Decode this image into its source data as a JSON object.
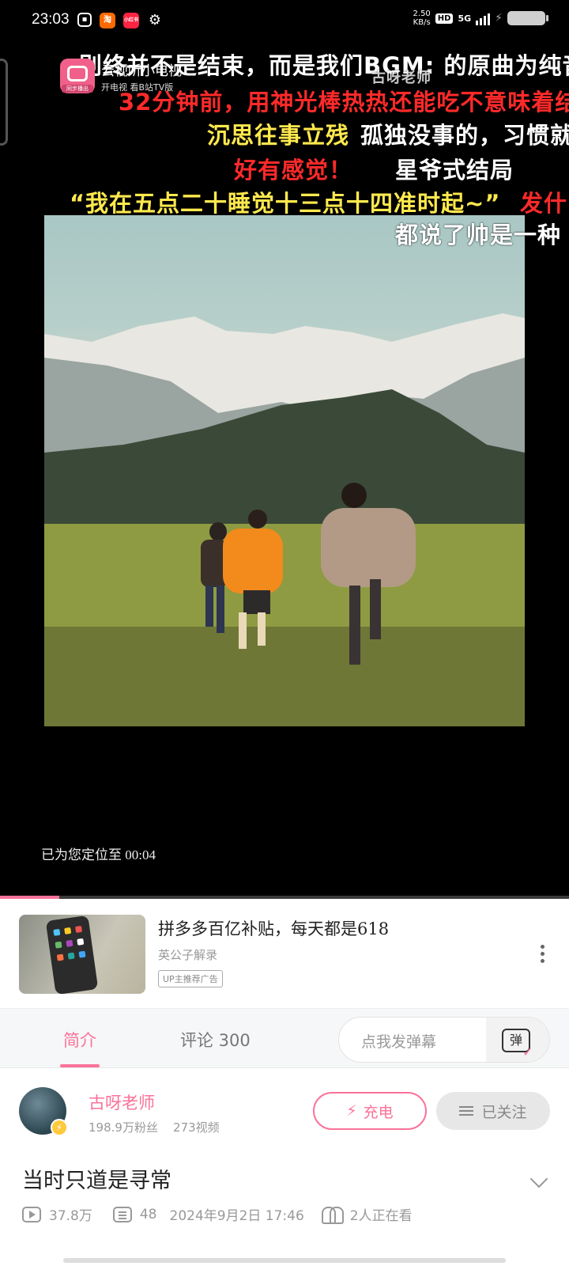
{
  "status_bar": {
    "time": "23:03",
    "apps": [
      "bilibili",
      "淘",
      "小红书",
      "settings"
    ],
    "net_speed_value": "2.50",
    "net_speed_unit": "KB/s",
    "hd_label": "HD",
    "network": "5G"
  },
  "overlay_app": {
    "title": "云视听小电视",
    "subtitle": "开电视 看B站TV版",
    "tag": "同步播出"
  },
  "danmaku": [
    {
      "text": "别终并不是结束，而是我们BGM: 的原曲为纯音",
      "color": "white"
    },
    {
      "text": "古呀老师",
      "color": "white"
    },
    {
      "text": "32分钟前，用神光棒热热还能吃不意味着结",
      "color": "red"
    },
    {
      "text": "沉思往事立残",
      "color": "yellow"
    },
    {
      "text": "孤独没事的，习惯就",
      "color": "white"
    },
    {
      "text": "好有感觉！",
      "color": "red"
    },
    {
      "text": "星爷式结局",
      "color": "white"
    },
    {
      "text": "“我在五点二十睡觉十三点十四准时起~”",
      "color": "yellow"
    },
    {
      "text": "发什",
      "color": "red"
    },
    {
      "text": "都说了帅是一种",
      "color": "white"
    }
  ],
  "player": {
    "resume_text": "已为您定位至 00:04",
    "progress": 0.104
  },
  "ad": {
    "title": "拼多多百亿补贴，每天都是618",
    "subtitle": "英公子解录",
    "tag": "UP主推荐广告"
  },
  "tabs": {
    "intro": "简介",
    "comments": "评论 300",
    "danmaku_placeholder": "点我发弹幕",
    "danmaku_button": "弹"
  },
  "uploader": {
    "name": "古呀老师",
    "fans": "198.9万粉丝",
    "videos": "273视频",
    "charge_label": "充电",
    "follow_label": "已关注"
  },
  "video": {
    "title": "当时只道是寻常",
    "views": "37.8万",
    "danmaku_count": "48",
    "date": "2024年9月2日 17:46",
    "watching": "2人正在看"
  },
  "colors": {
    "accent": "#fb7299",
    "danmaku_red": "#ff2a2a",
    "danmaku_yellow": "#ffe94d"
  }
}
